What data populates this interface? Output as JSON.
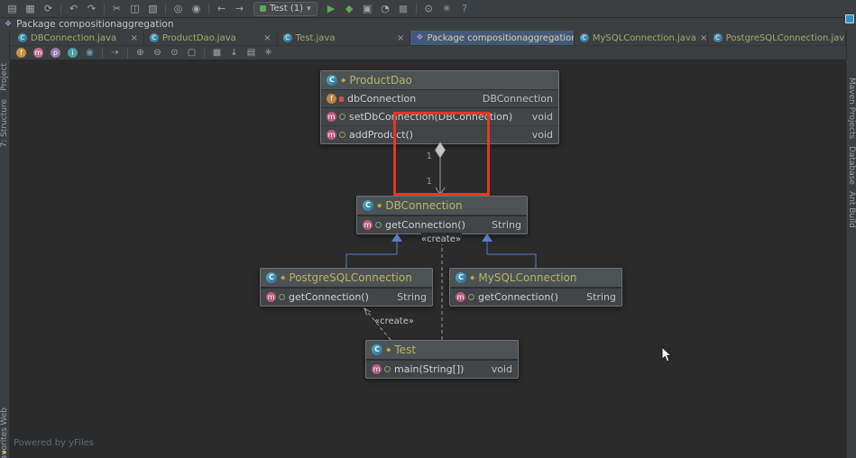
{
  "breadcrumb": {
    "text": "Package compositionaggregation"
  },
  "ui": {
    "close_glyph": "×",
    "caret_glyph": "▾",
    "star_glyph": "★"
  },
  "toolbar": {
    "run_config": "Test (1)",
    "icons": [
      {
        "name": "open-icon",
        "glyph": "▤"
      },
      {
        "name": "save-all-icon",
        "glyph": "▦"
      },
      {
        "name": "sync-icon",
        "glyph": "⟳"
      },
      {
        "name": "undo-icon",
        "glyph": "↶"
      },
      {
        "name": "redo-icon",
        "glyph": "↷"
      },
      {
        "name": "cut-icon",
        "glyph": "✂"
      },
      {
        "name": "copy-icon",
        "glyph": "◫"
      },
      {
        "name": "paste-icon",
        "glyph": "▧"
      },
      {
        "name": "find-icon",
        "glyph": "◎"
      },
      {
        "name": "replace-icon",
        "glyph": "◉"
      },
      {
        "name": "back-icon",
        "glyph": "←"
      },
      {
        "name": "forward-icon",
        "glyph": "→"
      },
      {
        "name": "run-icon",
        "glyph": "▶"
      },
      {
        "name": "debug-icon",
        "glyph": "◆"
      },
      {
        "name": "coverage-icon",
        "glyph": "▣"
      },
      {
        "name": "profiler-icon",
        "glyph": "◔"
      },
      {
        "name": "stop-icon",
        "glyph": "■"
      },
      {
        "name": "search-everywhere-icon",
        "glyph": "⊙"
      },
      {
        "name": "settings-icon",
        "glyph": "✳"
      },
      {
        "name": "help-icon",
        "glyph": "?"
      }
    ]
  },
  "tabs": [
    {
      "label": "DBConnection.java",
      "icon": "C",
      "active": false
    },
    {
      "label": "ProductDao.java",
      "icon": "C",
      "active": false
    },
    {
      "label": "Test.java",
      "icon": "C",
      "active": false
    },
    {
      "label": "Package compositionaggregation",
      "icon": "❖",
      "active": true
    },
    {
      "label": "MySQLConnection.java",
      "icon": "C",
      "active": false
    },
    {
      "label": "PostgreSQLConnection.java",
      "icon": "C",
      "active": false
    }
  ],
  "diagram_toolbar": {
    "icons": [
      {
        "name": "show-fields-icon",
        "glyph": "f",
        "color": "#c98f41"
      },
      {
        "name": "show-methods-icon",
        "glyph": "m",
        "color": "#c46d8d"
      },
      {
        "name": "show-properties-icon",
        "glyph": "p",
        "color": "#9876aa"
      },
      {
        "name": "show-inner-classes-icon",
        "glyph": "i",
        "color": "#4f9e9e"
      },
      {
        "name": "visibility-level-icon",
        "glyph": "◉",
        "color": "#6897bb"
      },
      {
        "name": "dependencies-icon",
        "glyph": "⇢"
      },
      {
        "name": "zoom-in-icon",
        "glyph": "⊕"
      },
      {
        "name": "zoom-out-icon",
        "glyph": "⊖"
      },
      {
        "name": "actual-size-icon",
        "glyph": "⊙"
      },
      {
        "name": "fit-content-icon",
        "glyph": "▢"
      },
      {
        "name": "grid-icon",
        "glyph": "▦"
      },
      {
        "name": "export-image-icon",
        "glyph": "↓"
      },
      {
        "name": "print-icon",
        "glyph": "▤"
      },
      {
        "name": "diagram-settings-icon",
        "glyph": "✳"
      }
    ]
  },
  "tool_windows": {
    "left": [
      {
        "label": "Project"
      },
      {
        "label": "7: Structure"
      }
    ],
    "left_bottom": [
      {
        "label": "Web"
      },
      {
        "label": "Favorites"
      }
    ],
    "right": [
      {
        "label": "Maven Projects"
      },
      {
        "label": "Database"
      },
      {
        "label": "Ant Build"
      }
    ]
  },
  "footer": {
    "powered_by": "Powered by yFiles"
  },
  "uml": {
    "icons": {
      "class_glyph": "C",
      "field_glyph": "f",
      "method_glyph": "m"
    },
    "classes": [
      {
        "name": "ProductDao",
        "fields": [
          {
            "name": "dbConnection",
            "type": "DBConnection"
          }
        ],
        "methods": [
          {
            "name": "setDbConnection(DBConnection)",
            "type": "void"
          },
          {
            "name": "addProduct()",
            "type": "void"
          }
        ]
      },
      {
        "name": "DBConnection",
        "methods": [
          {
            "name": "getConnection()",
            "type": "String"
          }
        ]
      },
      {
        "name": "PostgreSQLConnection",
        "methods": [
          {
            "name": "getConnection()",
            "type": "String"
          }
        ]
      },
      {
        "name": "MySQLConnection",
        "methods": [
          {
            "name": "getConnection()",
            "type": "String"
          }
        ]
      },
      {
        "name": "Test",
        "methods": [
          {
            "name": "main(String[])",
            "type": "void"
          }
        ]
      }
    ],
    "edge_labels": {
      "source_multiplicity": "1",
      "target_multiplicity": "1",
      "create_db": "«create»",
      "create_postgres": "«create»"
    }
  },
  "colors": {
    "highlight_red": "#e53528",
    "inheritance_blue": "#5a7bc4",
    "class_title": "#b7b565",
    "canvas_bg": "#2b2b2b"
  }
}
